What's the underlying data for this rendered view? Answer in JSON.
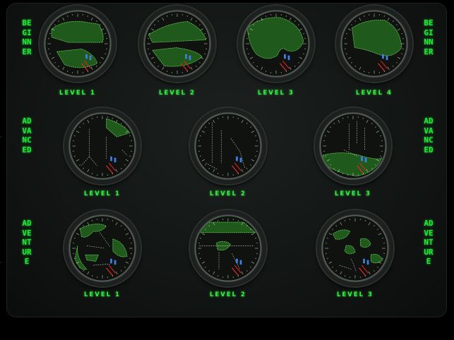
{
  "sections": {
    "beginner": {
      "label": "BEGINNER",
      "levels": [
        "LEVEL 1",
        "LEVEL 2",
        "LEVEL 3",
        "LEVEL 4"
      ]
    },
    "advanced": {
      "label": "ADVANCED",
      "levels": [
        "LEVEL 1",
        "LEVEL 2",
        "LEVEL 3"
      ]
    },
    "adventure": {
      "label": "ADVENTURE",
      "levels": [
        "LEVEL 1",
        "LEVEL 2",
        "LEVEL 3"
      ]
    }
  },
  "colors": {
    "accent": "#2ee640",
    "radar_bg": "#0f120f",
    "land": "#1f5a1c",
    "land_edge": "#6fd35d",
    "tick": "#d9e8d4",
    "threat": "#d8282a",
    "friendly": "#3f7de0"
  },
  "icons": {
    "radar": "radar-scope-icon"
  }
}
